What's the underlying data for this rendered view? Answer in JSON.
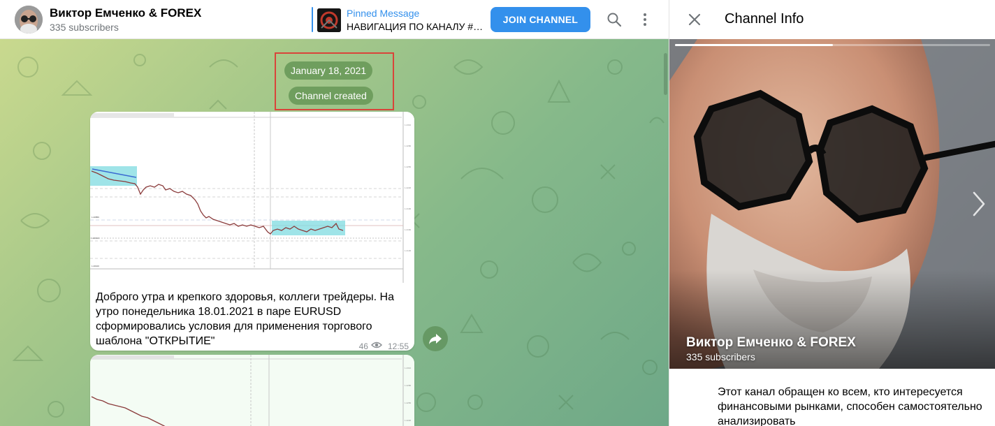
{
  "header": {
    "channel_title": "Виктор Емченко & FOREX",
    "subscribers": "335 subscribers",
    "pinned_label": "Pinned Message",
    "pinned_text": "НАВИГАЦИЯ ПО КАНАЛУ #в...",
    "join_label": "JOIN CHANNEL",
    "icons": [
      "search-icon",
      "more-vertical-icon"
    ]
  },
  "chat": {
    "date_pill": "January 18, 2021",
    "service_pill": "Channel created",
    "message": {
      "text": "Доброго утра и крепкого здоровья, коллеги трейдеры. На утро понедельника 18.01.2021 в паре EURUSD сформировались условия для применения торгового шаблона \"ОТКРЫТИЕ\"",
      "views": "46",
      "time": "12:55"
    },
    "forward_icon": "share-arrow-icon"
  },
  "panel": {
    "title": "Channel Info",
    "photo_name": "Виктор Емченко & FOREX",
    "photo_subscribers": "335 subscribers",
    "photo_progress": 0.5,
    "description": "Этот канал обращен ко всем, кто интересуется финансовыми рынками, способен самостоятельно анализировать"
  },
  "colors": {
    "accent": "#3390ec",
    "service_pill": "#6f9e5e",
    "highlight_box": "#d9443a"
  }
}
